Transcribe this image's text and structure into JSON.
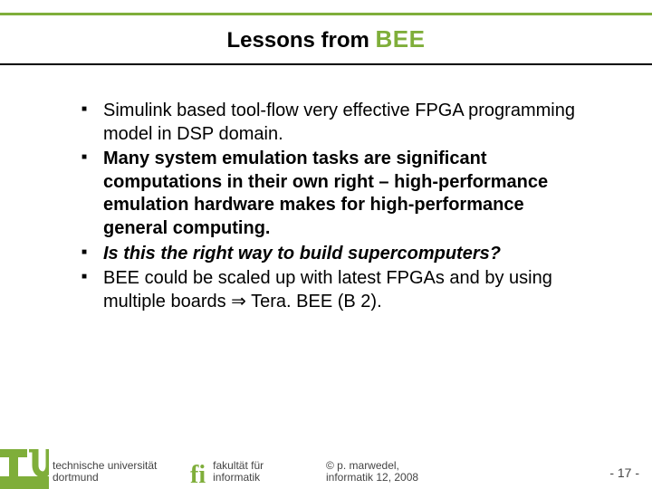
{
  "title": {
    "prefix": "Lessons from ",
    "accent": "BEE"
  },
  "bullets": [
    {
      "text": "Simulink based tool-flow very effective FPGA programming model in DSP domain.",
      "style": "normal"
    },
    {
      "text": "Many system emulation tasks are significant computations in their own right – high-performance emulation hardware makes for high-performance general computing.",
      "style": "bold"
    },
    {
      "text": "Is this the right way to build supercomputers?",
      "style": "bolditalic"
    },
    {
      "text": "BEE could be scaled up with latest FPGAs and by using multiple boards ⇒ Tera. BEE (B 2).",
      "style": "normal"
    }
  ],
  "footer": {
    "uni_line1": "technische universität",
    "uni_line2": "dortmund",
    "fi_logo": "fi",
    "fak_line1": "fakultät für",
    "fak_line2": "informatik",
    "copy_line1": "©  p. marwedel,",
    "copy_line2": "informatik 12,  2008",
    "page": "-  17 -"
  },
  "colors": {
    "accent": "#7fae3a"
  }
}
